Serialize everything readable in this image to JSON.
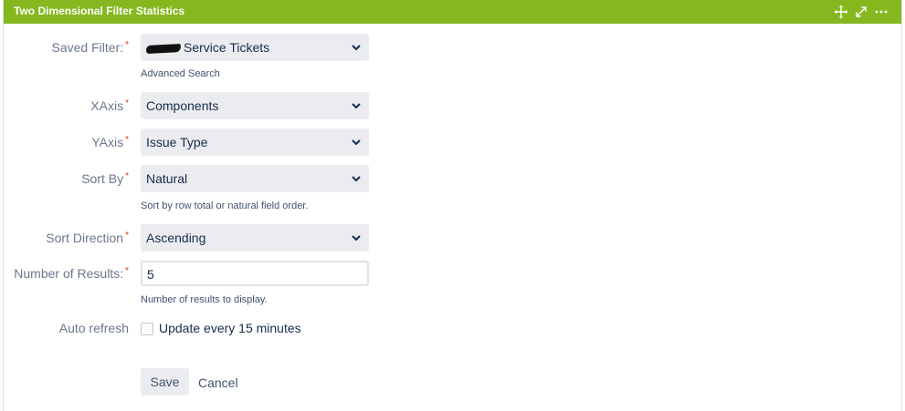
{
  "header": {
    "title": "Two Dimensional Filter Statistics",
    "icons": [
      "move-icon",
      "expand-icon",
      "more-icon"
    ],
    "color": "#85b81f"
  },
  "form": {
    "saved_filter": {
      "label": "Saved Filter:",
      "value": "Service Tickets",
      "link": "Advanced Search"
    },
    "xaxis": {
      "label": "XAxis",
      "value": "Components"
    },
    "yaxis": {
      "label": "YAxis",
      "value": "Issue Type"
    },
    "sort_by": {
      "label": "Sort By",
      "value": "Natural",
      "help": "Sort by row total or natural field order."
    },
    "sort_direction": {
      "label": "Sort Direction",
      "value": "Ascending"
    },
    "num_results": {
      "label": "Number of Results:",
      "value": "5",
      "help": "Number of results to display."
    },
    "auto_refresh": {
      "label": "Auto refresh",
      "checkbox_label": "Update every 15 minutes",
      "checked": false
    },
    "required_marker": "*",
    "save_label": "Save",
    "cancel_label": "Cancel"
  }
}
